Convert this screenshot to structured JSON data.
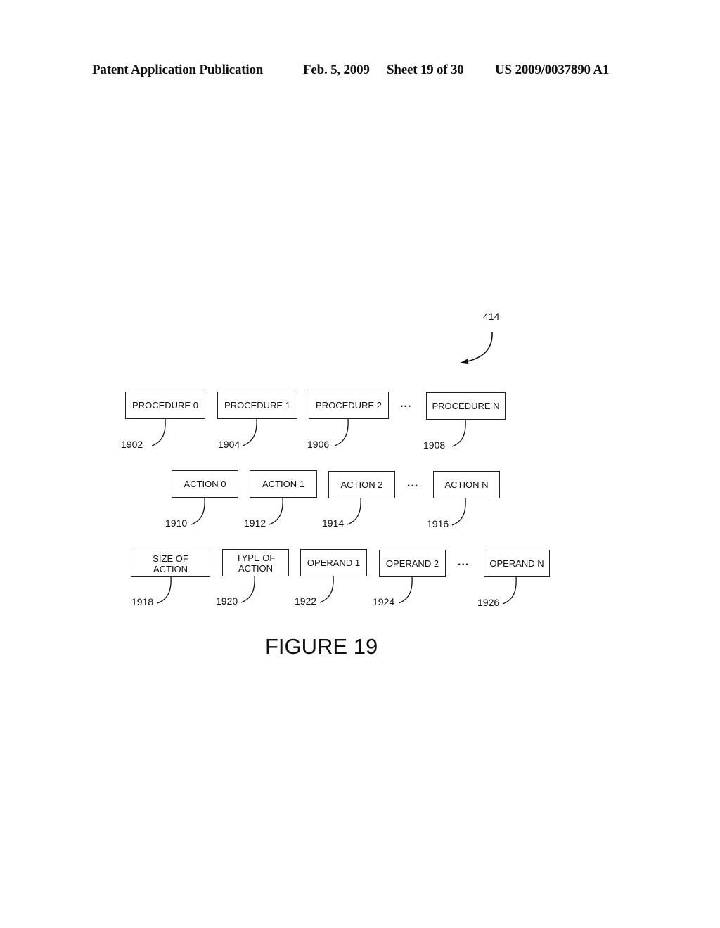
{
  "header": {
    "publication": "Patent Application Publication",
    "date": "Feb. 5, 2009",
    "sheet": "Sheet 19 of 30",
    "number": "US 2009/0037890 A1"
  },
  "diagram": {
    "pointer_ref": "414",
    "procedures": [
      {
        "label": "PROCEDURE 0",
        "ref": "1902"
      },
      {
        "label": "PROCEDURE 1",
        "ref": "1904"
      },
      {
        "label": "PROCEDURE 2",
        "ref": "1906"
      },
      {
        "label": "PROCEDURE N",
        "ref": "1908"
      }
    ],
    "actions": [
      {
        "label": "ACTION 0",
        "ref": "1910"
      },
      {
        "label": "ACTION 1",
        "ref": "1912"
      },
      {
        "label": "ACTION 2",
        "ref": "1914"
      },
      {
        "label": "ACTION N",
        "ref": "1916"
      }
    ],
    "action_fields": [
      {
        "label_line1": "SIZE OF",
        "label_line2": "ACTION",
        "ref": "1918"
      },
      {
        "label_line1": "TYPE OF",
        "label_line2": "ACTION",
        "ref": "1920"
      },
      {
        "label": "OPERAND 1",
        "ref": "1922"
      },
      {
        "label": "OPERAND 2",
        "ref": "1924"
      },
      {
        "label": "OPERAND N",
        "ref": "1926"
      }
    ],
    "ellipsis": "...",
    "figure_caption": "FIGURE 19"
  }
}
